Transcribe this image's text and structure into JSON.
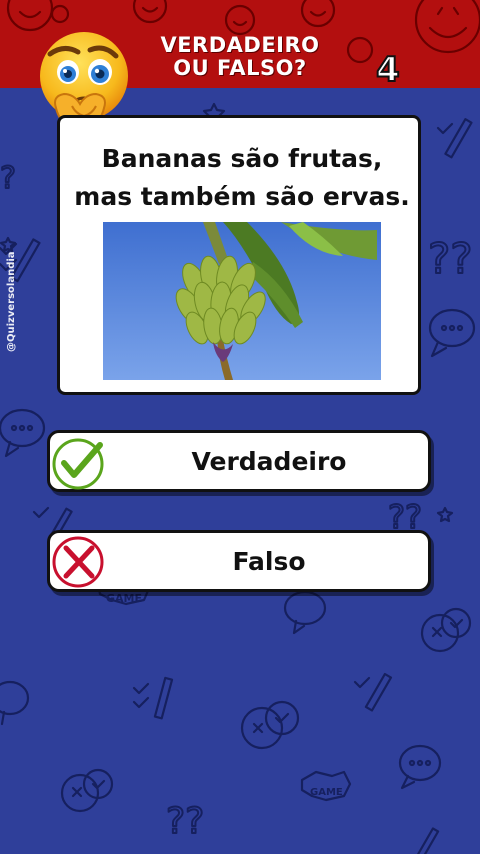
{
  "header": {
    "title_line1": "VERDADEIRO",
    "title_line2": "OU FALSO?",
    "question_number": "4"
  },
  "watermark": "@Quizversolandia",
  "question": {
    "line1": "Bananas são frutas,",
    "line2": "mas também são ervas."
  },
  "answers": [
    {
      "label": "Verdadeiro",
      "icon": "check-icon",
      "color": "#5aa51c"
    },
    {
      "label": "Falso",
      "icon": "x-mark-icon",
      "color": "#c8102e"
    }
  ],
  "colors": {
    "background": "#2f3f9a",
    "header": "#b30f0f",
    "card": "#ffffff"
  }
}
